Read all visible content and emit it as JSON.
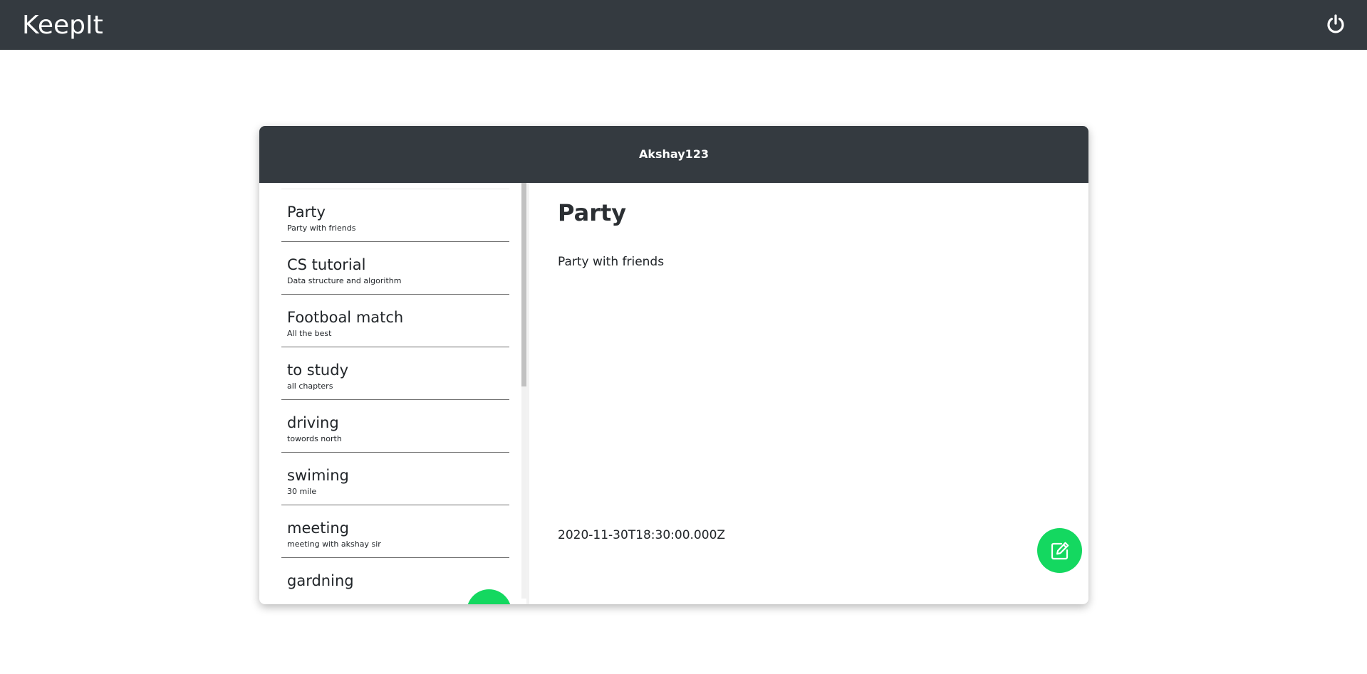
{
  "app": {
    "brand": "KeepIt",
    "power_icon": "power-icon"
  },
  "card": {
    "username": "Akshay123"
  },
  "notes": [
    {
      "title": "Party",
      "desc": "Party with friends"
    },
    {
      "title": "CS tutorial",
      "desc": "Data structure and algorithm"
    },
    {
      "title": "Footboal match",
      "desc": "All the best"
    },
    {
      "title": "to study",
      "desc": "all chapters"
    },
    {
      "title": "driving",
      "desc": "towords north"
    },
    {
      "title": "swiming",
      "desc": "30 mile"
    },
    {
      "title": "meeting",
      "desc": "meeting with akshay sir"
    },
    {
      "title": "gardning",
      "desc": ""
    }
  ],
  "detail": {
    "title": "Party",
    "desc": "Party with friends",
    "date": "2020-11-30T18:30:00.000Z"
  },
  "buttons": {
    "add_icon": "plus-icon",
    "edit_icon": "edit-icon"
  },
  "colors": {
    "navbar": "#343a40",
    "fab": "#14d860"
  }
}
